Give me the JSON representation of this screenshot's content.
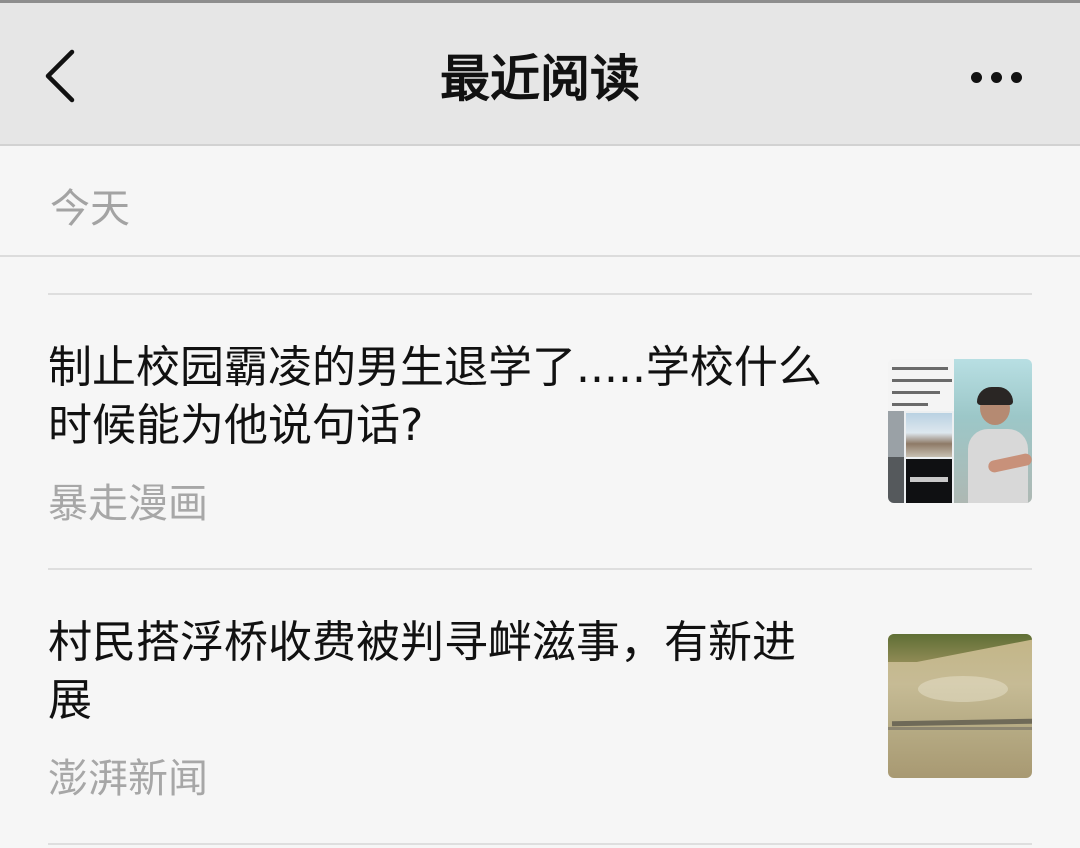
{
  "header": {
    "title": "最近阅读"
  },
  "section": {
    "label": "今天"
  },
  "articles": [
    {
      "title": "制止校园霸凌的男生退学了.....学校什么时候能为他说句话?",
      "source": "暴走漫画"
    },
    {
      "title": "村民搭浮桥收费被判寻衅滋事，有新进展",
      "source": "澎湃新闻"
    }
  ],
  "icons": {
    "back": "back-chevron-icon",
    "more": "more-dots-icon"
  },
  "colors": {
    "navbar_bg": "#e6e6e6",
    "page_bg": "#f6f6f6",
    "title_text": "#111111",
    "secondary_text": "#a7a7a7"
  }
}
